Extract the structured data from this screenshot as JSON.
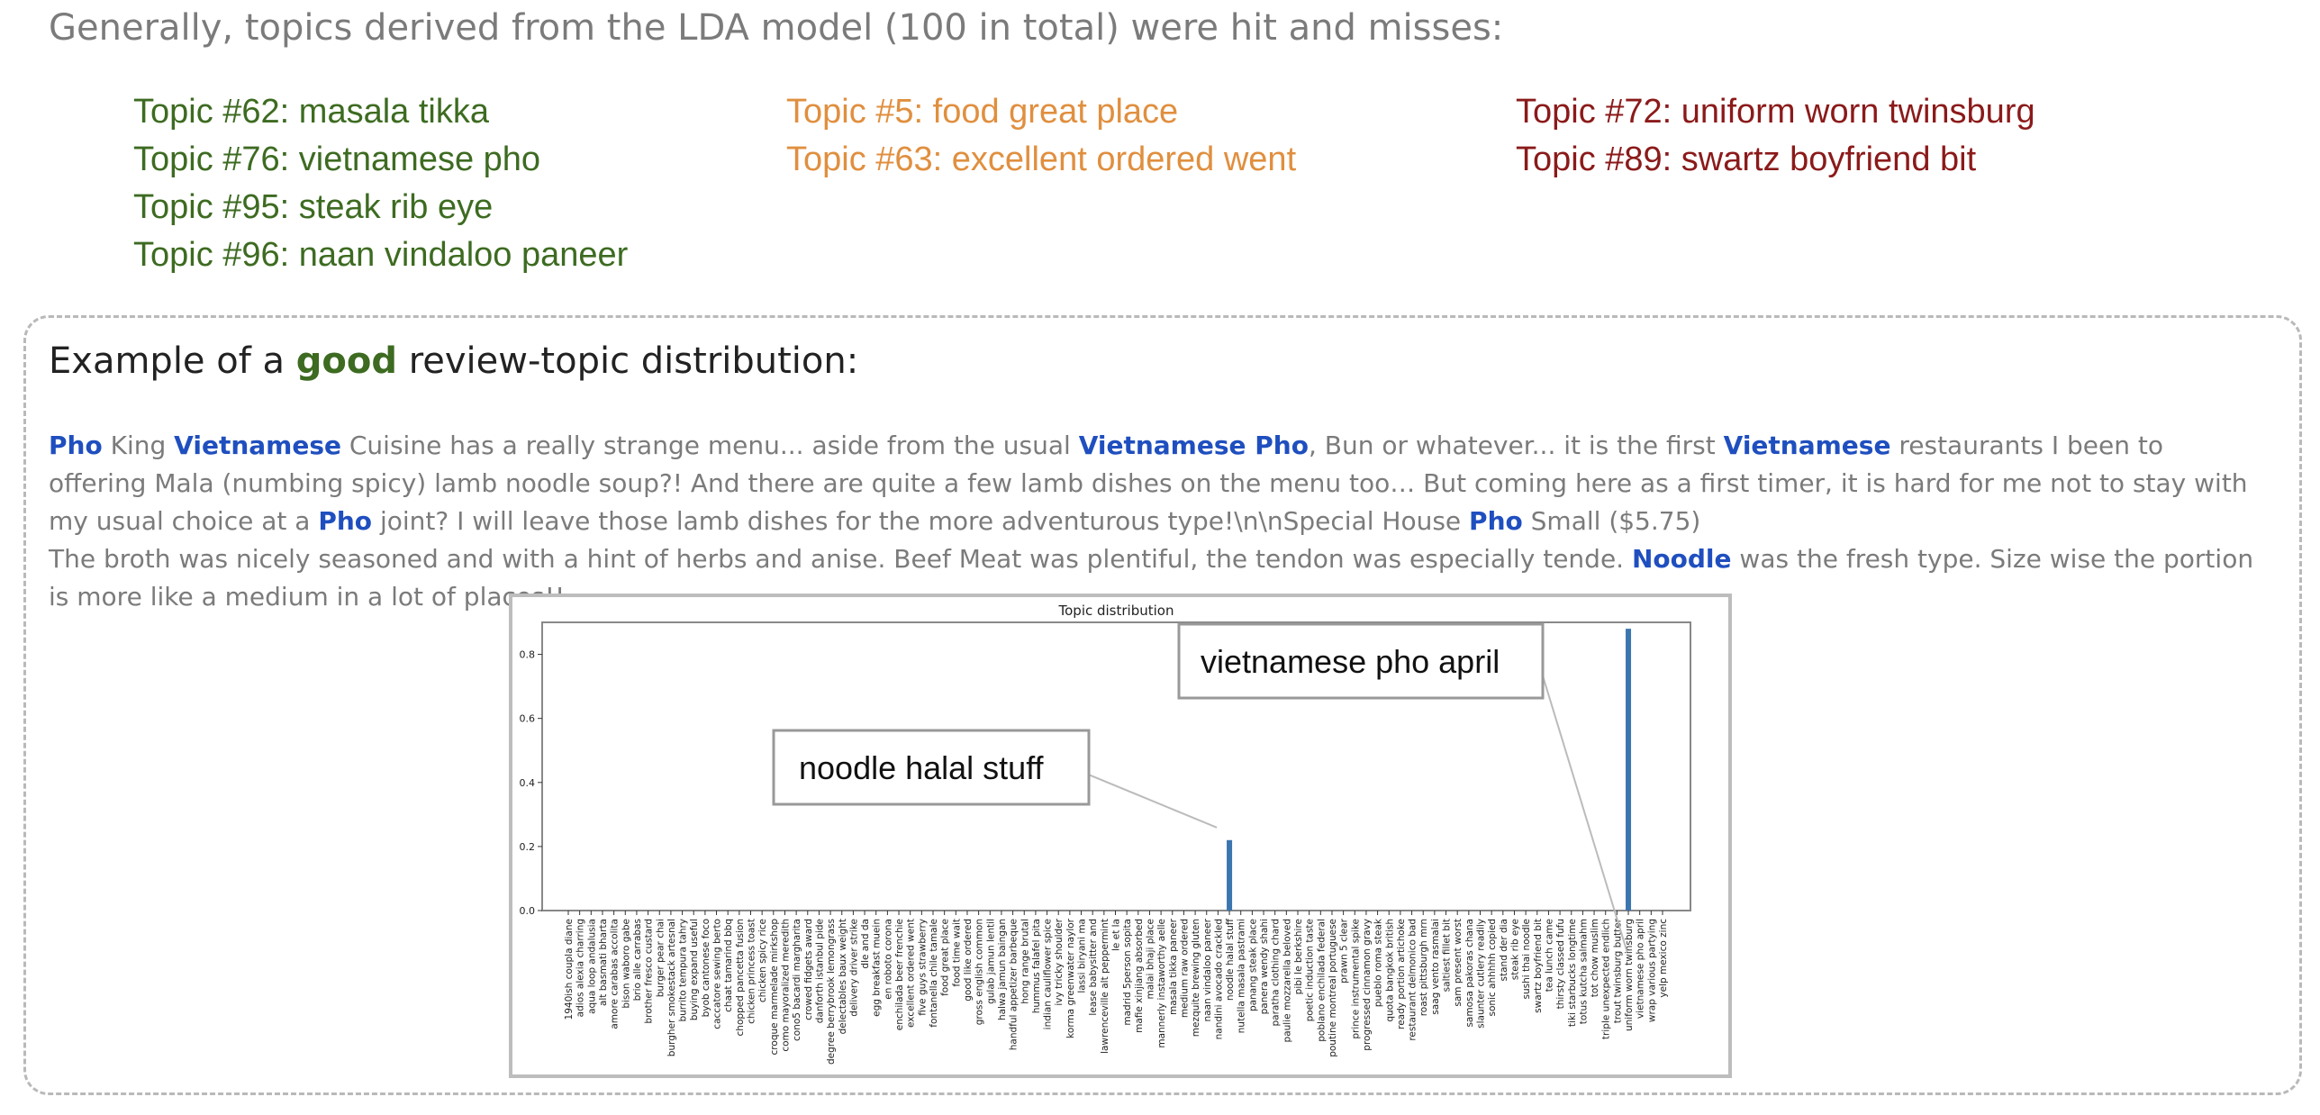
{
  "intro": "Generally, topics derived from the LDA model (100 in total) were hit and misses:",
  "topic_groups": {
    "good": [
      "Topic #62: masala tikka",
      "Topic #76: vietnamese pho",
      "Topic #95: steak rib eye",
      "Topic #96: naan vindaloo paneer"
    ],
    "mixed": [
      "Topic #5: food great place",
      "Topic #63: excellent ordered went"
    ],
    "bad": [
      "Topic #72: uniform worn twinsburg",
      "Topic #89: swartz boyfriend bit"
    ]
  },
  "colors": {
    "good": "#3d6b21",
    "mixed": "#e08f3f",
    "bad": "#8b1a1a",
    "keyword": "#1f4fbf",
    "bar": "#3b76af"
  },
  "example": {
    "title_prefix": "Example of a ",
    "title_emphasis": "good",
    "title_suffix": " review-topic distribution:",
    "review": {
      "s1": "Pho",
      "s2": " King ",
      "s3": "Vietnamese",
      "s4": " Cuisine has a really strange menu... aside from the usual ",
      "s5": "Vietnamese Pho",
      "s6": ", Bun or whatever... it is the first ",
      "s7": "Vietnamese",
      "s8": " restaurants I been to offering Mala (numbing spicy) lamb noodle soup?! And there are quite a few lamb dishes on the menu too… But coming here as a first timer, it is hard for me not to stay with my usual choice at a ",
      "s9": "Pho",
      "s10": " joint? I will leave those lamb dishes for the more adventurous type!\\n\\nSpecial House ",
      "s11": "Pho",
      "s12": " Small ($5.75)",
      "s13": "The broth was nicely seasoned and with a hint of herbs and anise. Beef Meat was plentiful, the tendon was especially tende. ",
      "s14": "Noodle",
      "s15": " was the fresh type. Size wise the portion is more like a medium in a lot of places!!"
    }
  },
  "chart_data": {
    "type": "bar",
    "title": "Topic distribution",
    "ylim": [
      0,
      0.9
    ],
    "yticks": [
      "0.0",
      "0.2",
      "0.4",
      "0.6",
      "0.8"
    ],
    "categories": [
      "1940ish coupla diane",
      "adios alexia charring",
      "aqua loop andalusia",
      "alt basmati bharta",
      "amore carabas accolita",
      "bison waboro gabe",
      "brio alle carrabas",
      "brother fresco custard",
      "burger pear chai",
      "burgher smokestack artesnal",
      "burrito tempura tahry",
      "buying expand useful",
      "byob cantonese foco",
      "caccatore sewing berto",
      "chaat tamarind bbq",
      "chopped pancetta fusion",
      "chicken princess toast",
      "chicken spicy rice",
      "croque marmelade mirkshop",
      "como mayoralized meredith",
      "cono5 bacardi margharita",
      "crowed fidgets award",
      "danforth istanbul pide",
      "degree berrybrook lemongrass",
      "delectables baux weight",
      "delivery driver strike",
      "dle and da",
      "egg breakfast muein",
      "en roboto corona",
      "enchilada beer frenchie",
      "excellent ordered went",
      "five guys strawberry",
      "fontanella chile tamale",
      "food great place",
      "food time wait",
      "good like ordered",
      "gross english common",
      "gulab jamun lentil",
      "halwa jamun baingan",
      "handful appetizer barbeque",
      "hong range brutal",
      "hummus falafel pita",
      "indian cauliflower spice",
      "ivy tricky shoulder",
      "korma greenwater naylor",
      "lassi biryani ma",
      "lease babysitter and",
      "lawrenceville alt peppermint",
      "le et la",
      "madrid 5person sopita",
      "mafie xinjiang absorbed",
      "malai bhaji place",
      "mannerly instaworthy aelle",
      "masala tikka paneer",
      "medium raw ordered",
      "mezquite brewing gluten",
      "naan vindaloo paneer",
      "nandini avocado crackled",
      "noodle halal stuff",
      "nutella masala pastrami",
      "panang steak place",
      "panera wendy shahi",
      "paratha clothing chard",
      "paulie mozzarella beloved",
      "pibi le berkshire",
      "poetic induction taste",
      "poblano enchilada federal",
      "poutine montreal portuguese",
      "prawn 5 clear",
      "prince instrumental spike",
      "progressed cinnamon gravy",
      "pueblo roma steak",
      "quota bangkok british",
      "ready portion artichoke",
      "restaurant delmonico bad",
      "roast pittsburgh mrn",
      "saag vento rasmalai",
      "saltiest fillet bit",
      "sam present worst",
      "samosa pakoras chana",
      "slaunter cutlery readily",
      "sonic ahhhhh copied",
      "stand der dia",
      "steak rib eye",
      "sushi thai noodle",
      "swartz boyfriend bit",
      "tea lunch came",
      "thirsty classed fufu",
      "tiki starbucks longtime",
      "totus kutcha salmahm",
      "tot chow muslim",
      "triple unexpected endlich",
      "trout twinsburg butter",
      "uniform worn twinsburg",
      "vietnamese pho april",
      "wrap various partying",
      "yelp mexico zinc"
    ],
    "values": [
      0,
      0,
      0,
      0,
      0,
      0,
      0,
      0,
      0,
      0,
      0,
      0,
      0,
      0,
      0,
      0,
      0,
      0,
      0,
      0,
      0,
      0,
      0,
      0,
      0,
      0,
      0,
      0,
      0,
      0,
      0,
      0,
      0,
      0,
      0,
      0,
      0,
      0,
      0,
      0,
      0,
      0,
      0,
      0,
      0,
      0,
      0,
      0,
      0,
      0,
      0,
      0,
      0,
      0,
      0,
      0,
      0,
      0,
      0.22,
      0,
      0,
      0,
      0,
      0,
      0,
      0,
      0,
      0,
      0,
      0,
      0,
      0,
      0,
      0,
      0,
      0,
      0,
      0,
      0,
      0,
      0,
      0,
      0,
      0,
      0,
      0,
      0,
      0,
      0,
      0,
      0,
      0,
      0,
      0.88,
      0,
      0
    ],
    "annotations": [
      {
        "text": "noodle halal stuff",
        "category": "noodle halal stuff"
      },
      {
        "text": "vietnamese pho april",
        "category": "vietnamese pho april"
      }
    ]
  }
}
